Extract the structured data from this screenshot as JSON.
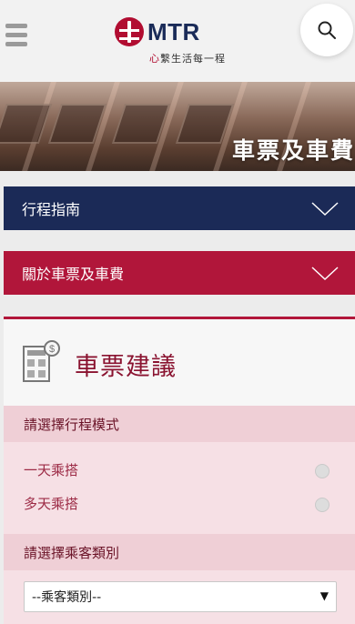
{
  "header": {
    "logo_text": "MTR",
    "tagline_prefix": "心",
    "tagline_rest": "繫生活每一程",
    "menu_icon": "hamburger-icon",
    "search_icon": "search-icon"
  },
  "banner": {
    "title": "車票及車費"
  },
  "nav": {
    "trip_guide": "行程指南",
    "about_fares": "關於車票及車費"
  },
  "card": {
    "title": "車票建議",
    "icon": "calculator-dollar-icon",
    "trip_mode_heading": "請選擇行程模式",
    "options": [
      "一天乘搭",
      "多天乘搭"
    ],
    "passenger_heading": "請選擇乘客類別",
    "passenger_select_value": "--乘客類別--"
  },
  "colors": {
    "navy": "#1b2a57",
    "crimson": "#b1163a",
    "pink_section": "#efcfd6"
  }
}
